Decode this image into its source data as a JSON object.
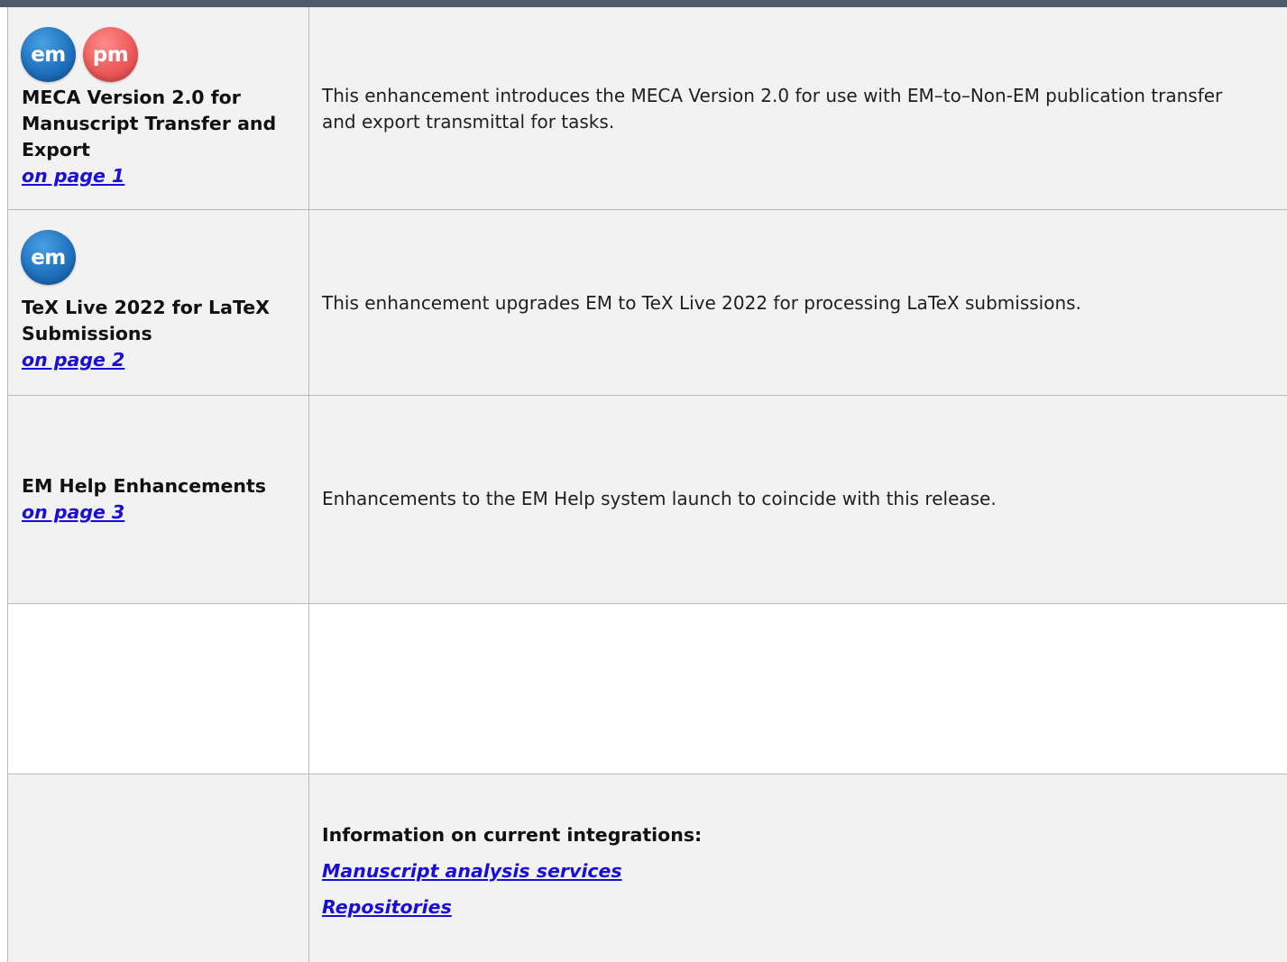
{
  "rows": [
    {
      "icons": [
        "em",
        "pm"
      ],
      "title": "MECA Version 2.0 for Manuscript Transfer and Export",
      "link": "on page 1",
      "description": "This enhancement introduces the MECA Version 2.0 for use with EM–to–Non-EM publication transfer and export transmittal for tasks."
    },
    {
      "icons": [
        "em"
      ],
      "title": "TeX Live 2022 for LaTeX Submissions",
      "link": "on page 2",
      "description": "This enhancement upgrades EM to TeX Live 2022 for processing LaTeX submissions."
    },
    {
      "title": "EM Help Enhancements",
      "link": "on page 3",
      "description": "Enhancements to the EM Help system launch to coincide with this release."
    }
  ],
  "integrations": {
    "heading": "Information on current integrations:",
    "links": [
      "Manuscript analysis services",
      "Repositories"
    ]
  },
  "colors": {
    "topbar": "#4d5b6b",
    "row_gray": "#f2f2f2",
    "link": "#1a0dd9",
    "em_badge": "#1f72c0",
    "pm_badge": "#ee5a5a"
  }
}
